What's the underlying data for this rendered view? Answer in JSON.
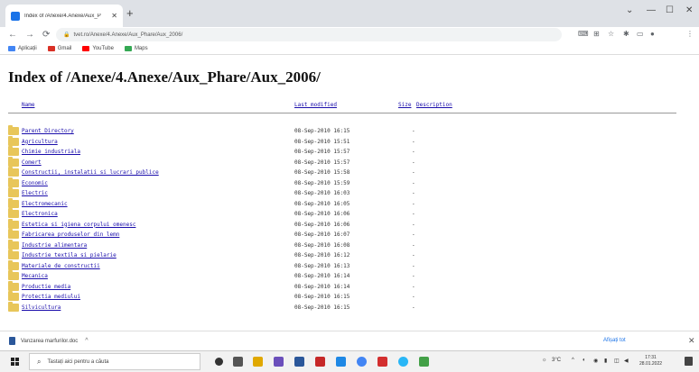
{
  "browser": {
    "tab_title": "Index of /Anexe/4.Anexe/Aux_P",
    "url": "tvet.ro/Anexe/4.Anexe/Aux_Phare/Aux_2006/",
    "bookmarks": [
      {
        "label": "Aplicații",
        "icon": "apps-icon",
        "color": "#4285f4"
      },
      {
        "label": "Gmail",
        "icon": "gmail-icon",
        "color": "#d93025"
      },
      {
        "label": "YouTube",
        "icon": "youtube-icon",
        "color": "#ff0000"
      },
      {
        "label": "Maps",
        "icon": "maps-icon",
        "color": "#34a853"
      }
    ]
  },
  "page": {
    "title": "Index of /Anexe/4.Anexe/Aux_Phare/Aux_2006/",
    "columns": {
      "name": "Name",
      "modified": "Last modified",
      "size": "Size",
      "description": "Description"
    },
    "rows": [
      {
        "name": "Parent Directory",
        "date": "08-Sep-2010 16:15",
        "size": "-"
      },
      {
        "name": "Agricultura",
        "date": "08-Sep-2010 15:51",
        "size": "-"
      },
      {
        "name": "Chimie industriala",
        "date": "08-Sep-2010 15:57",
        "size": "-"
      },
      {
        "name": "Comert",
        "date": "08-Sep-2010 15:57",
        "size": "-"
      },
      {
        "name": "Constructii, instalatii si lucrari publice",
        "date": "08-Sep-2010 15:58",
        "size": "-"
      },
      {
        "name": "Economic",
        "date": "08-Sep-2010 15:59",
        "size": "-"
      },
      {
        "name": "Electric",
        "date": "08-Sep-2010 16:03",
        "size": "-"
      },
      {
        "name": "Electromecanic",
        "date": "08-Sep-2010 16:05",
        "size": "-"
      },
      {
        "name": "Electronica",
        "date": "08-Sep-2010 16:06",
        "size": "-"
      },
      {
        "name": "Estetica si igiena corpului omenesc",
        "date": "08-Sep-2010 16:06",
        "size": "-"
      },
      {
        "name": "Fabricarea produselor din lemn",
        "date": "08-Sep-2010 16:07",
        "size": "-"
      },
      {
        "name": "Industrie alimentara",
        "date": "08-Sep-2010 16:08",
        "size": "-"
      },
      {
        "name": "Industrie textila si pielarie",
        "date": "08-Sep-2010 16:12",
        "size": "-"
      },
      {
        "name": "Materiale de constructii",
        "date": "08-Sep-2010 16:13",
        "size": "-"
      },
      {
        "name": "Mecanica",
        "date": "08-Sep-2010 16:14",
        "size": "-"
      },
      {
        "name": "Productie media",
        "date": "08-Sep-2010 16:14",
        "size": "-"
      },
      {
        "name": "Protectia mediului",
        "date": "08-Sep-2010 16:15",
        "size": "-"
      },
      {
        "name": "Silvicultura",
        "date": "08-Sep-2010 16:15",
        "size": "-"
      }
    ]
  },
  "download": {
    "filename": "Vanzarea marfurilor.doc",
    "show_all": "Afișați tot"
  },
  "taskbar": {
    "search_placeholder": "Tastați aici pentru a căuta",
    "temperature": "3°C",
    "time": "17:31",
    "date": "28.01.2022"
  }
}
